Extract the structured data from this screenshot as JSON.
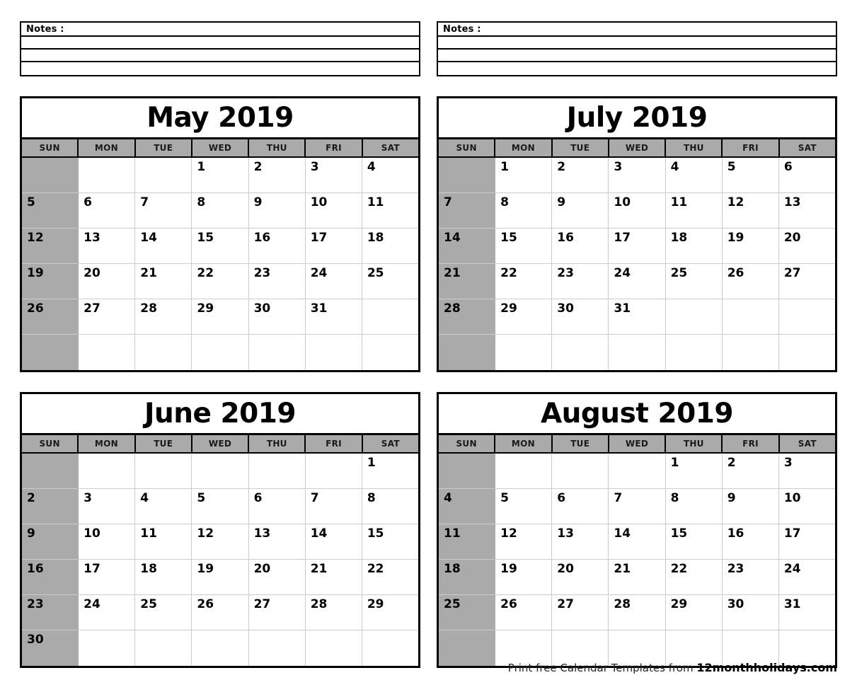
{
  "notes": {
    "label": "Notes :",
    "blank_line_count": 3
  },
  "weekdays": [
    "SUN",
    "MON",
    "TUE",
    "WED",
    "THU",
    "FRI",
    "SAT"
  ],
  "colors": {
    "header_gray": "#aaaaaa",
    "sunday_gray": "#aaaaaa",
    "border_black": "#000000",
    "gridline_gray": "#cccccc",
    "page_background": "#ffffff"
  },
  "calendars": [
    {
      "title": "May 2019",
      "month": "May",
      "year": "2019",
      "weeks": [
        [
          "",
          "",
          "",
          "1",
          "2",
          "3",
          "4"
        ],
        [
          "5",
          "6",
          "7",
          "8",
          "9",
          "10",
          "11"
        ],
        [
          "12",
          "13",
          "14",
          "15",
          "16",
          "17",
          "18"
        ],
        [
          "19",
          "20",
          "21",
          "22",
          "23",
          "24",
          "25"
        ],
        [
          "26",
          "27",
          "28",
          "29",
          "30",
          "31",
          ""
        ],
        [
          "",
          "",
          "",
          "",
          "",
          "",
          ""
        ]
      ]
    },
    {
      "title": "July 2019",
      "month": "July",
      "year": "2019",
      "weeks": [
        [
          "",
          "1",
          "2",
          "3",
          "4",
          "5",
          "6"
        ],
        [
          "7",
          "8",
          "9",
          "10",
          "11",
          "12",
          "13"
        ],
        [
          "14",
          "15",
          "16",
          "17",
          "18",
          "19",
          "20"
        ],
        [
          "21",
          "22",
          "23",
          "24",
          "25",
          "26",
          "27"
        ],
        [
          "28",
          "29",
          "30",
          "31",
          "",
          "",
          ""
        ],
        [
          "",
          "",
          "",
          "",
          "",
          "",
          ""
        ]
      ]
    },
    {
      "title": "June 2019",
      "month": "June",
      "year": "2019",
      "weeks": [
        [
          "",
          "",
          "",
          "",
          "",
          "",
          "1"
        ],
        [
          "2",
          "3",
          "4",
          "5",
          "6",
          "7",
          "8"
        ],
        [
          "9",
          "10",
          "11",
          "12",
          "13",
          "14",
          "15"
        ],
        [
          "16",
          "17",
          "18",
          "19",
          "20",
          "21",
          "22"
        ],
        [
          "23",
          "24",
          "25",
          "26",
          "27",
          "28",
          "29"
        ],
        [
          "30",
          "",
          "",
          "",
          "",
          "",
          ""
        ]
      ]
    },
    {
      "title": "August 2019",
      "month": "August",
      "year": "2019",
      "weeks": [
        [
          "",
          "",
          "",
          "",
          "1",
          "2",
          "3"
        ],
        [
          "4",
          "5",
          "6",
          "7",
          "8",
          "9",
          "10"
        ],
        [
          "11",
          "12",
          "13",
          "14",
          "15",
          "16",
          "17"
        ],
        [
          "18",
          "19",
          "20",
          "21",
          "22",
          "23",
          "24"
        ],
        [
          "25",
          "26",
          "27",
          "28",
          "29",
          "30",
          "31"
        ],
        [
          "",
          "",
          "",
          "",
          "",
          "",
          ""
        ]
      ]
    }
  ],
  "footer": {
    "prefix": "Print free Calendar Templates from ",
    "site": "12monthholidays.com"
  }
}
